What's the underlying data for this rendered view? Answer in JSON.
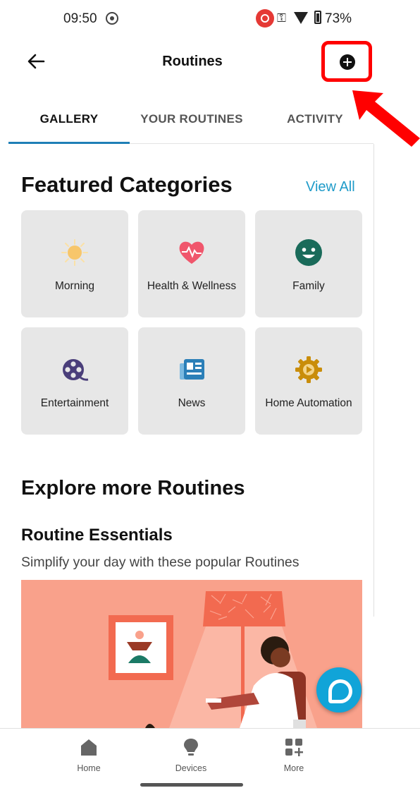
{
  "status_bar": {
    "time": "09:50",
    "battery": "73%"
  },
  "header": {
    "title": "Routines"
  },
  "tabs": [
    {
      "label": "GALLERY",
      "active": true
    },
    {
      "label": "YOUR ROUTINES",
      "active": false
    },
    {
      "label": "ACTIVITY",
      "active": false
    }
  ],
  "featured": {
    "title": "Featured Categories",
    "view_all": "View All",
    "categories": [
      {
        "label": "Morning",
        "icon": "sun-icon",
        "color": "#f7c66b"
      },
      {
        "label": "Health & Wellness",
        "icon": "heart-pulse-icon",
        "color": "#f0566c"
      },
      {
        "label": "Family",
        "icon": "smiley-icon",
        "color": "#1a6b5a"
      },
      {
        "label": "Entertainment",
        "icon": "film-reel-icon",
        "color": "#4a3e7a"
      },
      {
        "label": "News",
        "icon": "newspaper-icon",
        "color": "#2b7fb8"
      },
      {
        "label": "Home Automation",
        "icon": "gear-play-icon",
        "color": "#c98d0a"
      }
    ]
  },
  "explore": {
    "title": "Explore more Routines",
    "essentials_title": "Routine Essentials",
    "essentials_subtitle": "Simplify your day with these popular Routines"
  },
  "bottom_nav": [
    {
      "label": "Home",
      "icon": "home-icon"
    },
    {
      "label": "Devices",
      "icon": "bulb-icon"
    },
    {
      "label": "More",
      "icon": "grid-plus-icon"
    }
  ],
  "colors": {
    "accent": "#1f9bc9",
    "tab_indicator": "#1f7fb6",
    "highlight": "#ff0000",
    "alexa": "#11a4d8",
    "banner": "#f9a18b"
  }
}
